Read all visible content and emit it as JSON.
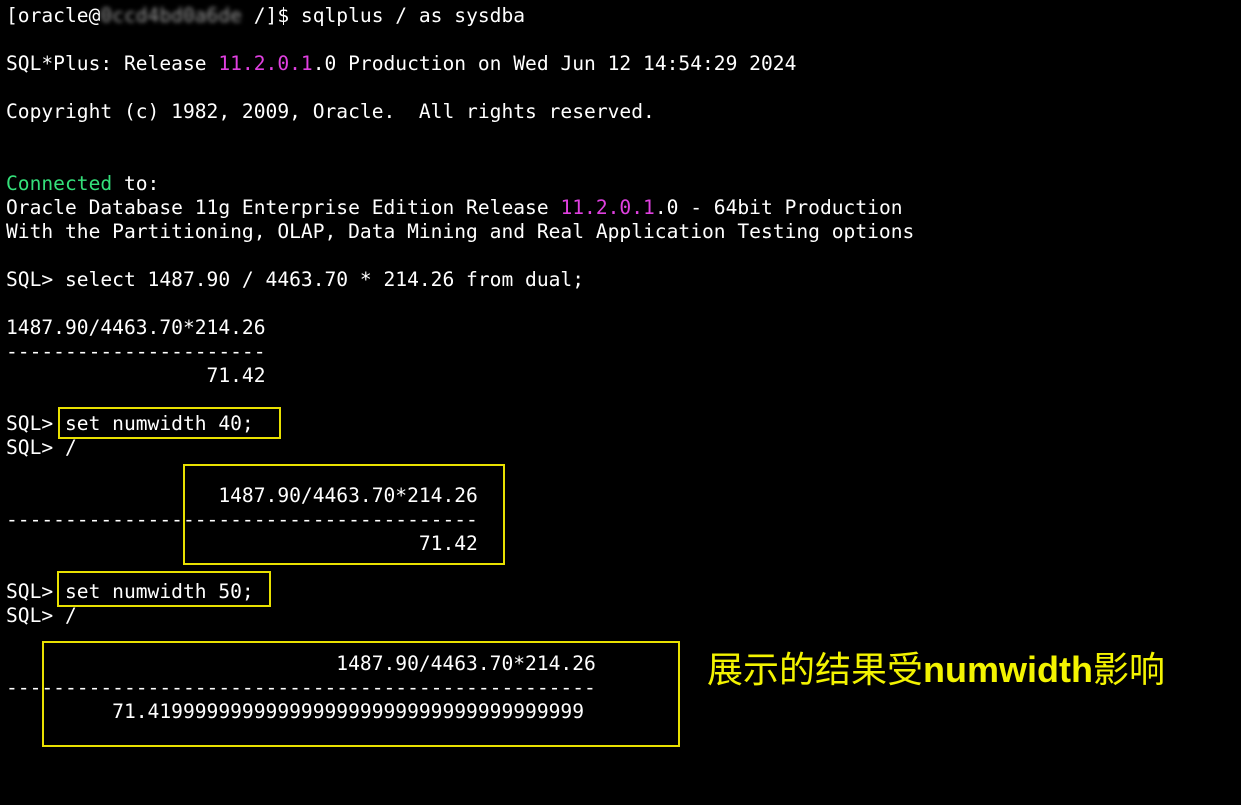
{
  "terminal": {
    "prompt_user": "[oracle@",
    "prompt_host": "0ccd4bd0a6de",
    "prompt_tail": " /]$ sqlplus / as sysdba",
    "banner_pre": "SQL*Plus: Release ",
    "banner_version": "11.2.0.1",
    "banner_post": ".0 Production on Wed Jun 12 14:54:29 2024",
    "copyright": "Copyright (c) 1982, 2009, Oracle.  All rights reserved.",
    "connected_word": "Connected",
    "connected_tail": " to:",
    "db_pre": "Oracle Database 11g Enterprise Edition Release ",
    "db_version": "11.2.0.1",
    "db_post": ".0 - 64bit Production",
    "options": "With the Partitioning, OLAP, Data Mining and Real Application Testing options",
    "query": "SQL> select 1487.90 / 4463.70 * 214.26 from dual;",
    "result1_header": "1487.90/4463.70*214.26",
    "result1_dashes": "----------------------",
    "result1_value": "                 71.42",
    "sql_prompt": "SQL> ",
    "cmd_numwidth_40": "set numwidth 40;",
    "rerun1": "SQL> /",
    "result2_header": "                  1487.90/4463.70*214.26",
    "result2_dashes": "----------------------------------------",
    "result2_value": "                                   71.42",
    "cmd_numwidth_50": "set numwidth 50;",
    "rerun2": "SQL> /",
    "result3_header": "                            1487.90/4463.70*214.26",
    "result3_dashes": "--------------------------------------------------",
    "result3_value": "         71.4199999999999999999999999999999999999"
  },
  "annotation": {
    "text_pre": "展示的结果受",
    "text_bold": "numwidth",
    "text_post": "影响"
  },
  "colors": {
    "background": "#000000",
    "text": "#ffffff",
    "version_highlight": "#e040e0",
    "connected_highlight": "#34e07a",
    "annotation_box": "#e8e000",
    "annotation_text": "#f3f300"
  }
}
